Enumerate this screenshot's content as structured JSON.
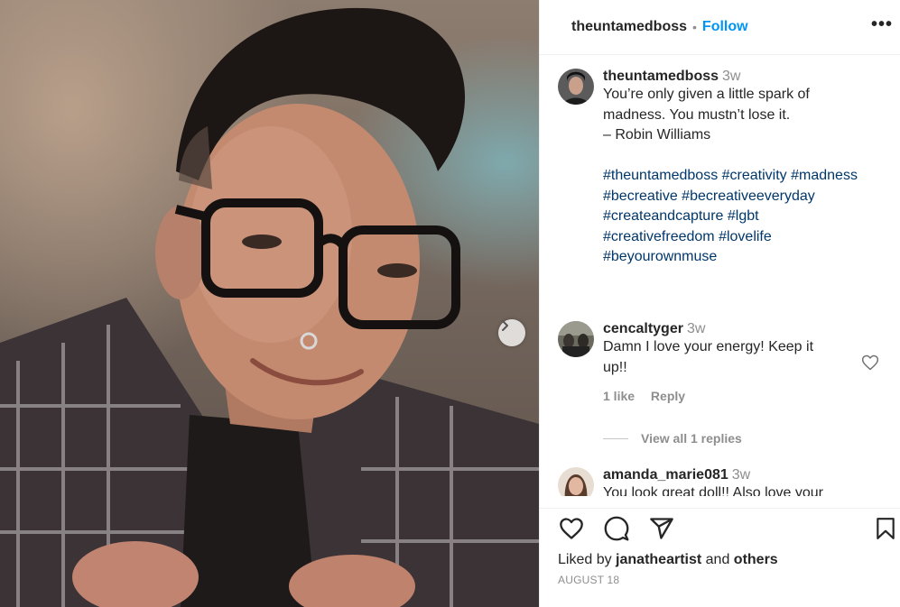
{
  "post": {
    "author": "theuntamedboss",
    "separator": "•",
    "follow_label": "Follow",
    "more_label": "•••"
  },
  "caption": {
    "author": "theuntamedboss",
    "time": "3w",
    "lines": [
      "You’re only given a little spark of",
      "madness. You mustn’t lose it.",
      "– Robin Williams"
    ],
    "hashtag_lines": [
      "#theuntamedboss #creativity #madness",
      "#becreative #becreativeeveryday",
      "#createandcapture #lgbt",
      "#creativefreedom #lovelife",
      "#beyourownmuse"
    ]
  },
  "comments": [
    {
      "author": "cencaltyger",
      "time": "3w",
      "lines": [
        "Damn I love your energy! Keep it",
        "up!!"
      ],
      "likes_label": "1 like",
      "reply_label": "Reply",
      "view_replies_label": "View all 1 replies"
    },
    {
      "author": "amanda_marie081",
      "time": "3w",
      "lines": [
        "You look great doll!! Also love your"
      ]
    }
  ],
  "footer": {
    "liked_by_prefix": "Liked by",
    "liked_by_user": "janatheartist",
    "liked_by_and": "and",
    "liked_by_others": "others",
    "date": "AUGUST 18"
  },
  "icons": {
    "like": "heart-icon",
    "comment": "comment-icon",
    "share": "paper-plane-icon",
    "save": "bookmark-icon",
    "next": "chevron-right-icon"
  },
  "colors": {
    "follow": "#0095f6",
    "hashtag": "#00376b",
    "muted": "#8e8e8e",
    "text": "#262626"
  }
}
